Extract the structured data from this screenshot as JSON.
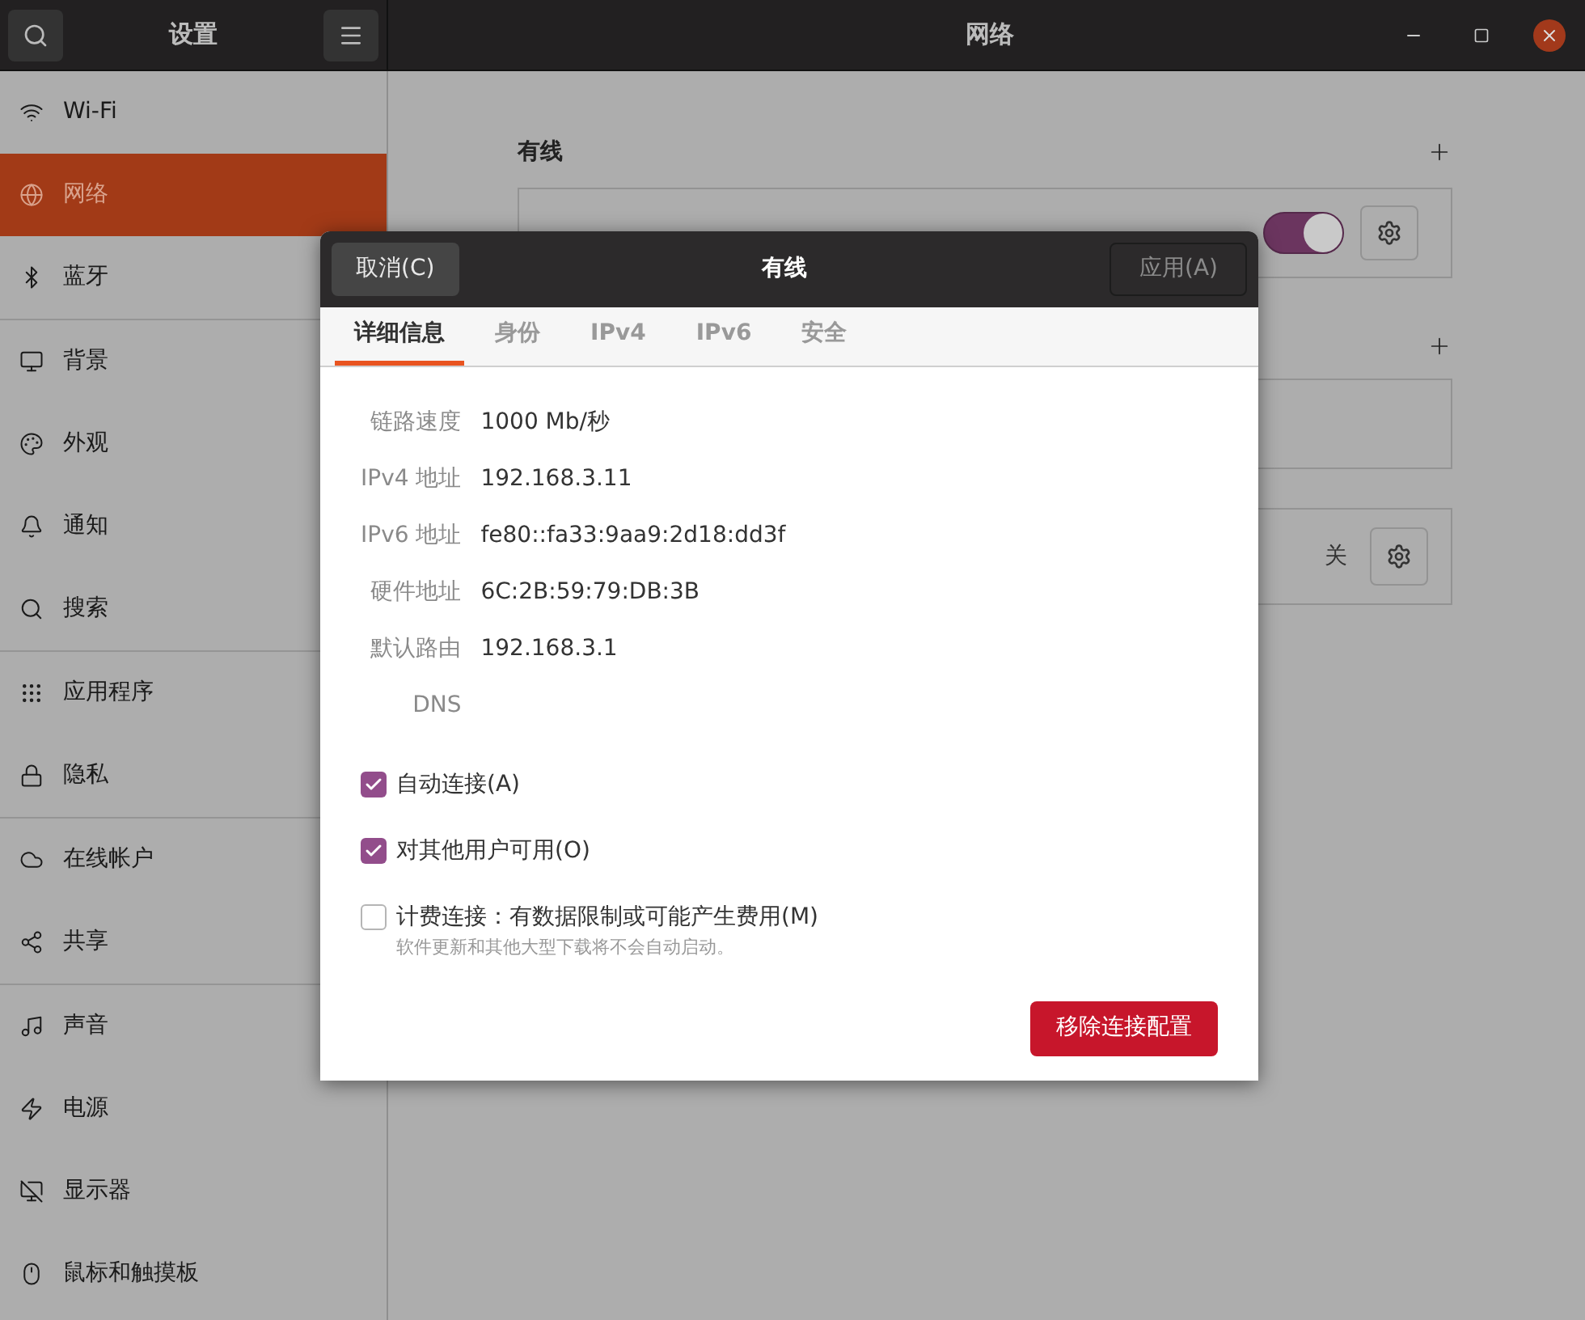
{
  "sidebar": {
    "title": "设置",
    "groups": [
      {
        "items": [
          {
            "label": "Wi-Fi",
            "selected": false
          },
          {
            "label": "网络",
            "selected": true
          },
          {
            "label": "蓝牙",
            "selected": false
          }
        ]
      },
      {
        "items": [
          {
            "label": "背景",
            "selected": false
          },
          {
            "label": "外观",
            "selected": false
          },
          {
            "label": "通知",
            "selected": false
          },
          {
            "label": "搜索",
            "selected": false
          }
        ]
      },
      {
        "items": [
          {
            "label": "应用程序",
            "selected": false
          },
          {
            "label": "隐私",
            "selected": false
          }
        ]
      },
      {
        "items": [
          {
            "label": "在线帐户",
            "selected": false
          },
          {
            "label": "共享",
            "selected": false
          }
        ]
      },
      {
        "items": [
          {
            "label": "声音",
            "selected": false
          },
          {
            "label": "电源",
            "selected": false
          },
          {
            "label": "显示器",
            "selected": false
          },
          {
            "label": "鼠标和触摸板",
            "selected": false
          }
        ]
      }
    ]
  },
  "window": {
    "title": "网络"
  },
  "wired": {
    "title": "有线",
    "on": true
  },
  "proxy": {
    "status": "关"
  },
  "dialog": {
    "title": "有线",
    "cancel": "取消(C)",
    "apply": "应用(A)",
    "tabs": [
      {
        "label": "详细信息",
        "selected": true
      },
      {
        "label": "身份",
        "selected": false
      },
      {
        "label": "IPv4",
        "selected": false
      },
      {
        "label": "IPv6",
        "selected": false
      },
      {
        "label": "安全",
        "selected": false
      }
    ],
    "details": [
      {
        "label": "链路速度",
        "value": "1000 Mb/秒"
      },
      {
        "label": "IPv4 地址",
        "value": "192.168.3.11"
      },
      {
        "label": "IPv6 地址",
        "value": "fe80::fa33:9aa9:2d18:dd3f"
      },
      {
        "label": "硬件地址",
        "value": "6C:2B:59:79:DB:3B"
      },
      {
        "label": "默认路由",
        "value": "192.168.3.1"
      },
      {
        "label": "DNS"
      }
    ],
    "options": [
      {
        "label": "自动连接(A)",
        "checked": true
      },
      {
        "label": "对其他用户可用(O)",
        "checked": true
      },
      {
        "label": "计费连接：有数据限制或可能产生费用(M)",
        "hint": "软件更新和其他大型下载将不会自动启动。",
        "checked": false
      }
    ],
    "remove": "移除连接配置"
  }
}
